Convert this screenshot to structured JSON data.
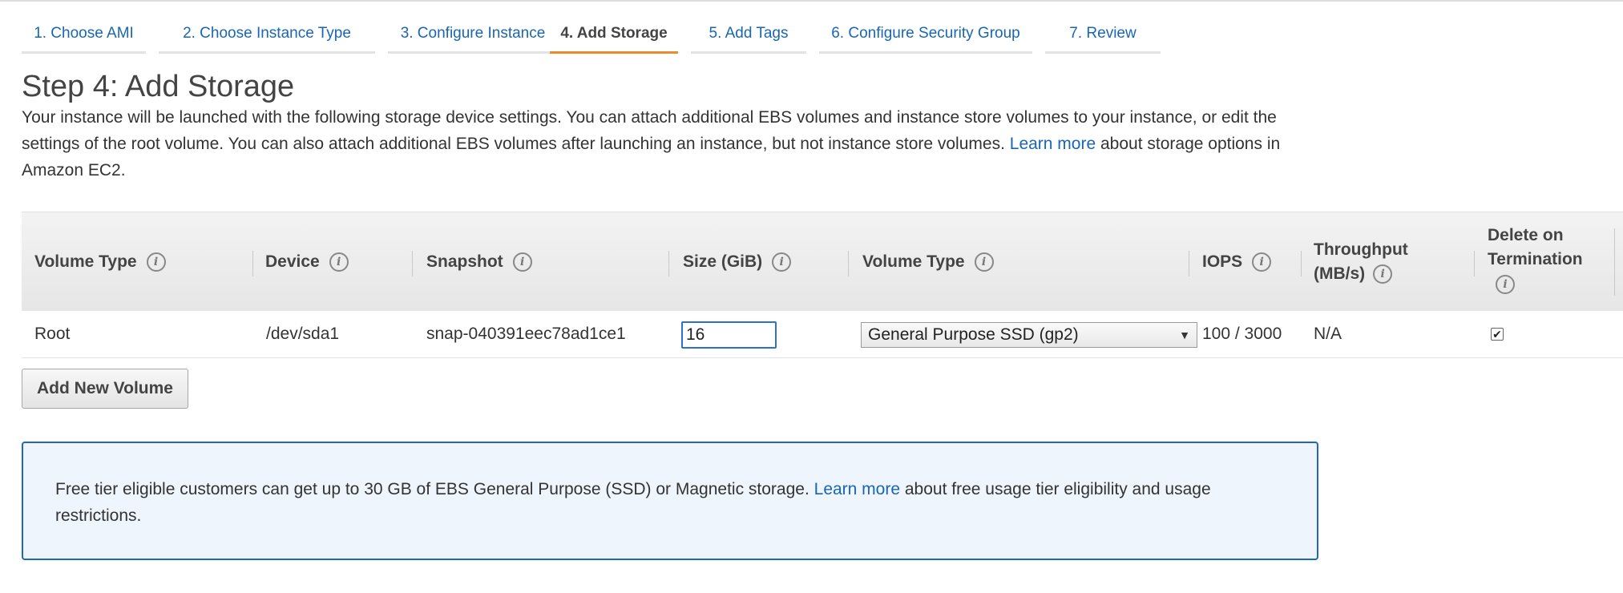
{
  "wizard": {
    "tabs": [
      {
        "label": "1. Choose AMI"
      },
      {
        "label": "2. Choose Instance Type"
      },
      {
        "label": "3. Configure Instance"
      },
      {
        "label": "4. Add Storage"
      },
      {
        "label": "5. Add Tags"
      },
      {
        "label": "6. Configure Security Group"
      },
      {
        "label": "7. Review"
      }
    ],
    "active_tab": "4. Add Storage"
  },
  "page": {
    "title": "Step 4: Add Storage",
    "description_part1": "Your instance will be launched with the following storage device settings. You can attach additional EBS volumes and instance store volumes to your instance, or edit the settings of the root volume. You can also attach additional EBS volumes after launching an instance, but not instance store volumes.",
    "learn_more_label": "Learn more",
    "description_part2": "about storage options in Amazon EC2."
  },
  "table": {
    "headers": {
      "volume_type": "Volume Type",
      "device": "Device",
      "snapshot": "Snapshot",
      "size": "Size (GiB)",
      "volume_type_2": "Volume Type",
      "iops": "IOPS",
      "throughput_line1": "Throughput",
      "throughput_line2": "(MB/s)",
      "delete_line1": "Delete on",
      "delete_line2": "Termination"
    },
    "rows": [
      {
        "volume_type": "Root",
        "device": "/dev/sda1",
        "snapshot": "snap-040391eec78ad1ce1",
        "size": "16",
        "ebs_volume_type": "General Purpose SSD (gp2)",
        "iops": "100 / 3000",
        "throughput": "N/A",
        "delete_on_termination": true
      }
    ]
  },
  "buttons": {
    "add_new_volume": "Add New Volume"
  },
  "info_box": {
    "text_part1": "Free tier eligible customers can get up to 30 GB of EBS General Purpose (SSD) or Magnetic storage.",
    "learn_more_label": "Learn more",
    "text_part2": "about free usage tier eligibility and usage restrictions."
  },
  "colors": {
    "link": "#1866b4",
    "active_tab_underline": "#ec8a2f",
    "info_border": "#1f65c4",
    "info_background": "#eef5fc"
  },
  "icons": {
    "info": "info-icon",
    "dropdown": "caret-down-icon",
    "check": "checkmark-icon"
  }
}
